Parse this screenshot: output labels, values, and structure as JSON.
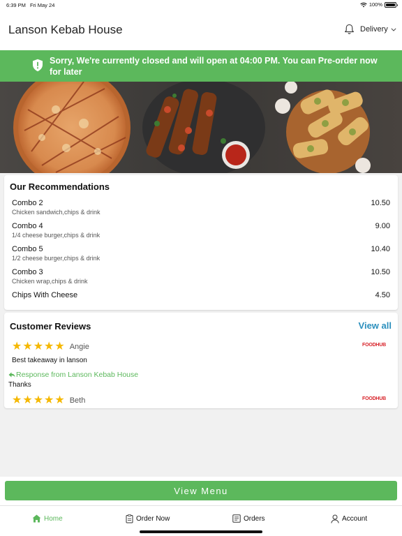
{
  "status_bar": {
    "time": "6:39 PM",
    "date": "Fri May 24",
    "battery_text": "100%",
    "battery_level": 1.0
  },
  "header": {
    "title": "Lanson Kebab House",
    "delivery_label": "Delivery"
  },
  "closed_banner": {
    "message": "Sorry, We're currently closed and will open at 04:00 PM. You can Pre-order now for later"
  },
  "recommendations": {
    "title": "Our Recommendations",
    "items": [
      {
        "name": "Combo 2",
        "description": "Chicken sandwich,chips & drink",
        "price": "10.50"
      },
      {
        "name": "Combo 4",
        "description": "1/4 cheese burger,chips & drink",
        "price": "9.00"
      },
      {
        "name": "Combo 5",
        "description": "1/2 cheese burger,chips & drink",
        "price": "10.40"
      },
      {
        "name": "Combo 3",
        "description": "Chicken wrap,chips & drink",
        "price": "10.50"
      },
      {
        "name": "Chips With Cheese",
        "description": "",
        "price": "4.50"
      }
    ]
  },
  "reviews": {
    "title": "Customer Reviews",
    "view_all": "View all",
    "items": [
      {
        "rating": 5,
        "reviewer": "Angie",
        "text": "Best takeaway in lanson",
        "source": "FOODHUB"
      },
      {
        "rating": 5,
        "reviewer": "Beth",
        "text": "",
        "source": "FOODHUB"
      }
    ],
    "response_label": "Response from Lanson Kebab House",
    "response_text": "Thanks"
  },
  "view_menu_label": "View Menu",
  "tab_bar": {
    "home": "Home",
    "order_now": "Order Now",
    "orders": "Orders",
    "account": "Account"
  },
  "colors": {
    "accent_green": "#5cb85c",
    "link_blue": "#2b8fbd",
    "star": "#f5b800",
    "foodhub_red": "#d8232a"
  }
}
